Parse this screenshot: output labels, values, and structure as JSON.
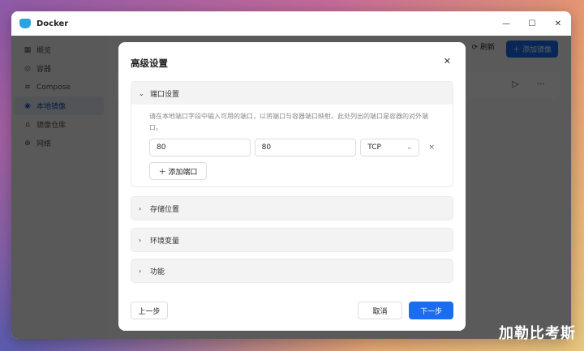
{
  "window": {
    "title": "Docker",
    "min": "—",
    "max": "☐",
    "close": "✕"
  },
  "sidebar": {
    "items": [
      {
        "icon": "▦",
        "label": "概览"
      },
      {
        "icon": "◎",
        "label": "容器"
      },
      {
        "icon": "≋",
        "label": "Compose"
      },
      {
        "icon": "◉",
        "label": "本地镜像"
      },
      {
        "icon": "⌂",
        "label": "镜像仓库"
      },
      {
        "icon": "⊕",
        "label": "网络"
      }
    ]
  },
  "toolbar": {
    "refresh": "⟳ 刷新",
    "add_image": "＋ 添加镜像"
  },
  "row": {
    "play": "▷",
    "more": "···"
  },
  "modal": {
    "title": "高级设置",
    "close": "✕",
    "port_section": {
      "label": "端口设置",
      "chev": "⌄",
      "desc": "请在本地端口字段中输入可用的端口，以将端口与容器端口映射。此处列出的端口是容器的对外端口。",
      "local_port": "80",
      "container_port": "80",
      "protocol": "TCP",
      "remove": "×",
      "add_port": "＋  添加端口"
    },
    "sections": [
      {
        "label": "存储位置"
      },
      {
        "label": "环境变量"
      },
      {
        "label": "功能"
      }
    ],
    "back": "上一步",
    "cancel": "取消",
    "next": "下一步"
  },
  "watermark": "加勒比考斯"
}
